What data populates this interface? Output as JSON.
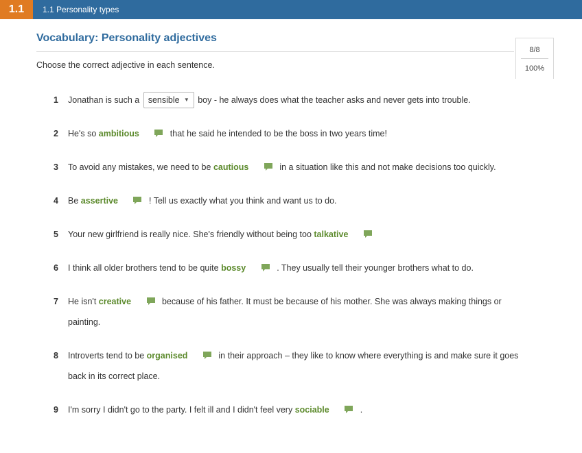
{
  "header": {
    "unit_number": "1.1",
    "title": "1.1 Personality types"
  },
  "exercise": {
    "title": "Vocabulary: Personality adjectives",
    "instructions": "Choose the correct adjective in each sentence."
  },
  "score": {
    "count": "8/8",
    "percent": "100%"
  },
  "questions": [
    {
      "num": "1",
      "before": "Jonathan is such a",
      "select_value": "sensible",
      "after": "boy - he always does what the teacher asks and never gets into trouble."
    },
    {
      "num": "2",
      "before": "He's so",
      "answer": "ambitious",
      "after": "that he said he intended to be the boss in two years time!"
    },
    {
      "num": "3",
      "before": "To avoid any mistakes, we need to be",
      "answer": "cautious",
      "after": "in a situation like this and not make decisions too quickly."
    },
    {
      "num": "4",
      "before": "Be",
      "answer": "assertive",
      "after": "! Tell us exactly what you think and want us to do."
    },
    {
      "num": "5",
      "before": "Your new girlfriend is really nice. She's friendly without being too",
      "answer": "talkative",
      "after": ""
    },
    {
      "num": "6",
      "before": "I think all older brothers tend to be quite",
      "answer": "bossy",
      "after": ". They usually tell their younger brothers what to do."
    },
    {
      "num": "7",
      "before": "He isn't",
      "answer": "creative",
      "after": "because of his father. It must be because of his mother. She was always making things or painting."
    },
    {
      "num": "8",
      "before": "Introverts tend to be",
      "answer": "organised",
      "after": "in their approach – they like to know where everything is and make sure it goes back in its correct place."
    },
    {
      "num": "9",
      "before": "I'm sorry I didn't go to the party. I felt ill and I didn't feel very",
      "answer": "sociable",
      "after": "."
    }
  ],
  "colors": {
    "header_blue": "#2f6b9e",
    "badge_orange": "#e07b22",
    "answer_green": "#5c8a2c",
    "icon_green": "#7fa65a"
  }
}
